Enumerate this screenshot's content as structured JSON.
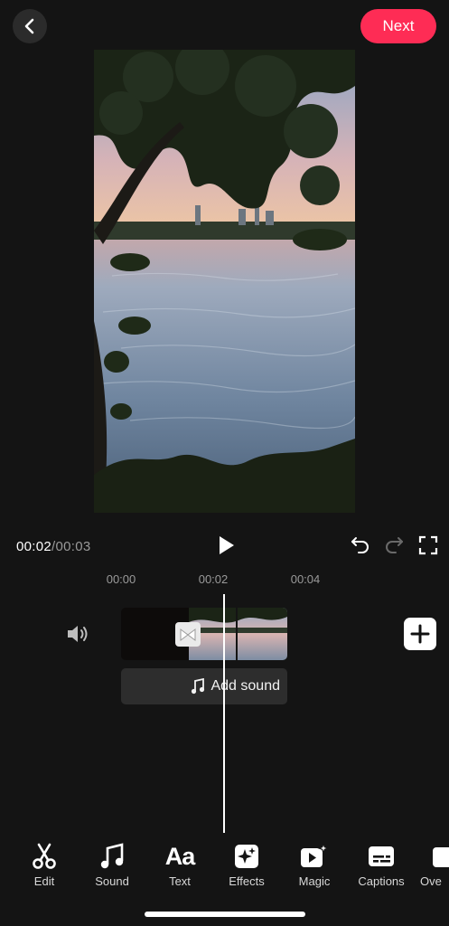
{
  "header": {
    "next_label": "Next",
    "back_icon": "chevron-left-icon",
    "accent": "#fe2c55"
  },
  "playback": {
    "current_time": "00:02",
    "separator": "/",
    "duration": "00:03"
  },
  "ruler": {
    "ticks": [
      "00:00",
      "00:02",
      "00:04"
    ]
  },
  "timeline": {
    "add_sound_label": "Add sound"
  },
  "toolbar": {
    "items": [
      {
        "label": "Edit",
        "icon": "scissors-icon"
      },
      {
        "label": "Sound",
        "icon": "music-note-icon"
      },
      {
        "label": "Text",
        "icon": "text-aa-icon"
      },
      {
        "label": "Effects",
        "icon": "sparkles-icon"
      },
      {
        "label": "Magic",
        "icon": "magic-video-icon"
      },
      {
        "label": "Captions",
        "icon": "captions-icon"
      },
      {
        "label": "Ove",
        "icon": "overlay-icon"
      }
    ]
  }
}
